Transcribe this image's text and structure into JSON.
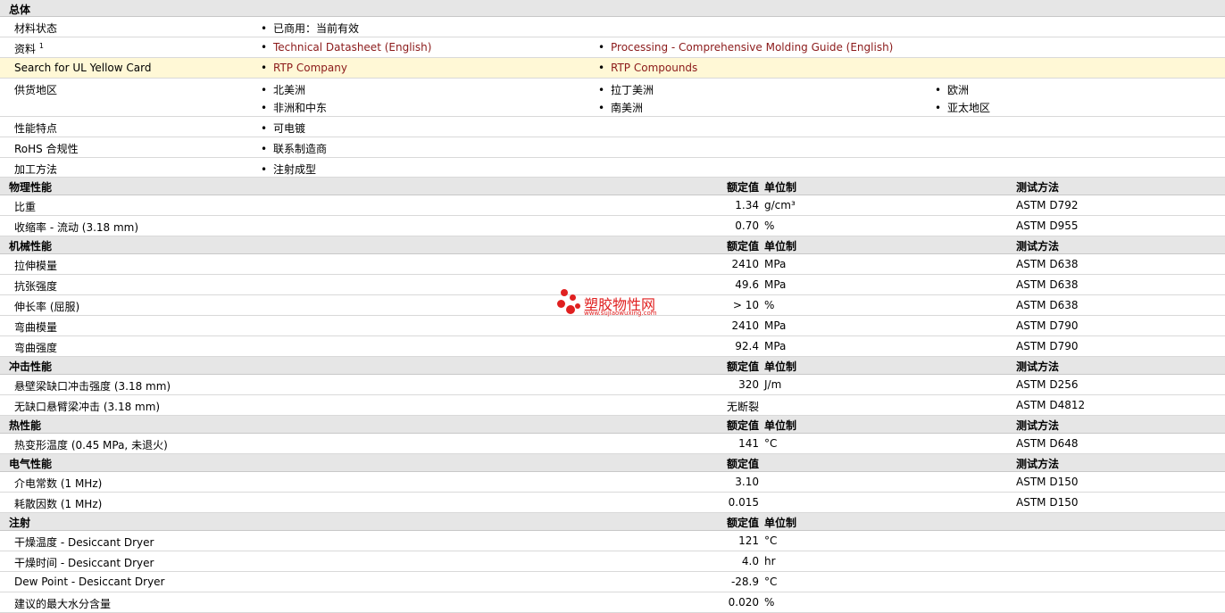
{
  "general": {
    "title": "总体",
    "material_status": {
      "label": "材料状态",
      "value": "已商用：当前有效"
    },
    "literature": {
      "label": "资料",
      "sup": "1",
      "link1": "Technical Datasheet (English)",
      "link2": "Processing - Comprehensive Molding Guide (English)"
    },
    "ul": {
      "label": "Search for UL Yellow Card",
      "link1": "RTP Company",
      "link2": "RTP Compounds"
    },
    "regions": {
      "label": "供货地区",
      "items": [
        "北美洲",
        "拉丁美洲",
        "欧洲",
        "非洲和中东",
        "南美洲",
        "亚太地区"
      ]
    },
    "features": {
      "label": "性能特点",
      "value": "可电镀"
    },
    "rohs": {
      "label": "RoHS 合规性",
      "value": "联系制造商"
    },
    "processing": {
      "label": "加工方法",
      "value": "注射成型"
    }
  },
  "headers": {
    "nominal": "额定值",
    "unit": "单位制",
    "method": "测试方法"
  },
  "physical": {
    "title": "物理性能",
    "rows": [
      {
        "prop": "比重",
        "val": "1.34",
        "unit": "g/cm³",
        "method": "ASTM D792"
      },
      {
        "prop": "收缩率  - 流动  (3.18 mm)",
        "val": "0.70",
        "unit": "%",
        "method": "ASTM D955"
      }
    ]
  },
  "mechanical": {
    "title": "机械性能",
    "rows": [
      {
        "prop": "拉伸模量",
        "val": "2410",
        "unit": "MPa",
        "method": "ASTM D638"
      },
      {
        "prop": "抗张强度",
        "val": "49.6",
        "unit": "MPa",
        "method": "ASTM D638"
      },
      {
        "prop": "伸长率  (屈服)",
        "val": "> 10",
        "unit": "%",
        "method": "ASTM D638"
      },
      {
        "prop": "弯曲模量",
        "val": "2410",
        "unit": "MPa",
        "method": "ASTM D790"
      },
      {
        "prop": "弯曲强度",
        "val": "92.4",
        "unit": "MPa",
        "method": "ASTM D790"
      }
    ]
  },
  "impact": {
    "title": "冲击性能",
    "rows": [
      {
        "prop": "悬壁梁缺口冲击强度  (3.18 mm)",
        "val": "320",
        "unit": "J/m",
        "method": "ASTM D256"
      },
      {
        "prop": "无缺口悬臂梁冲击  (3.18 mm)",
        "val": "无断裂",
        "unit": "",
        "method": "ASTM D4812"
      }
    ]
  },
  "thermal": {
    "title": "热性能",
    "rows": [
      {
        "prop": "热变形温度  (0.45 MPa, 未退火)",
        "val": "141",
        "unit": "°C",
        "method": "ASTM D648"
      }
    ]
  },
  "electrical": {
    "title": "电气性能",
    "rows": [
      {
        "prop": "介电常数  (1 MHz)",
        "val": "3.10",
        "unit": "",
        "method": "ASTM D150"
      },
      {
        "prop": "耗散因数  (1 MHz)",
        "val": "0.015",
        "unit": "",
        "method": "ASTM D150"
      }
    ]
  },
  "injection": {
    "title": "注射",
    "rows": [
      {
        "prop": "干燥温度  - Desiccant Dryer",
        "val": "121",
        "unit": "°C",
        "method": ""
      },
      {
        "prop": "干燥时间  - Desiccant Dryer",
        "val": "4.0",
        "unit": "hr",
        "method": ""
      },
      {
        "prop": "Dew Point - Desiccant Dryer",
        "val": "-28.9",
        "unit": "°C",
        "method": ""
      },
      {
        "prop": "建议的最大水分含量",
        "val": "0.020",
        "unit": "%",
        "method": ""
      }
    ]
  },
  "watermark": {
    "name": "塑胶物性网",
    "url": "www.sujiaowuxing.com"
  }
}
